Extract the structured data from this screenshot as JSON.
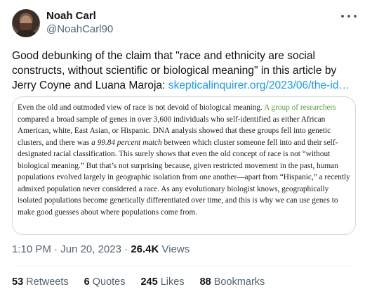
{
  "author": {
    "name": "Noah Carl",
    "handle": "@NoahCarl90"
  },
  "tweet": {
    "text_before_link": "Good debunking of the claim that \"race and ethnicity are social constructs, without scientific or biological meaning\" in this article by Jerry Coyne and Luana Maroja: ",
    "link": "skepticalinquirer.org/2023/06/the-id…"
  },
  "excerpt": {
    "part1": "Even the old and outmoded view of race is not devoid of biological meaning. ",
    "link_text": "A group of researchers",
    "part2": " compared a broad sample of genes in over 3,600 individuals who self-identified as either African American, white, East Asian, or Hispanic. DNA analysis showed that these groups fell into genetic clusters, and there was ",
    "italic": "a 99.84 percent match",
    "part3": " between which cluster someone fell into and their self-designated racial classification. This surely shows that even the old concept of race is not “without biological meaning.” But that’s not surprising because, given restricted movement in the past, human populations evolved largely in geographic isolation from one another—apart from “Hispanic,” a recently admixed population never considered a race. As any evolutionary biologist knows, geographically isolated populations become genetically differentiated over time, and this is why we can use genes to make good guesses about where populations come from."
  },
  "meta": {
    "time": "1:10 PM",
    "separator": "·",
    "date": "Jun 20, 2023",
    "views_count": "26.4K",
    "views_label": "Views"
  },
  "stats": {
    "retweets_count": "53",
    "retweets_label": "Retweets",
    "quotes_count": "6",
    "quotes_label": "Quotes",
    "likes_count": "245",
    "likes_label": "Likes",
    "bookmarks_count": "88",
    "bookmarks_label": "Bookmarks"
  },
  "colors": {
    "accent": "#1d9bf0",
    "secondary_text": "#536471",
    "excerpt_link": "#5a9a3a"
  },
  "icons": [
    "avatar-photo",
    "more-options-icon"
  ]
}
